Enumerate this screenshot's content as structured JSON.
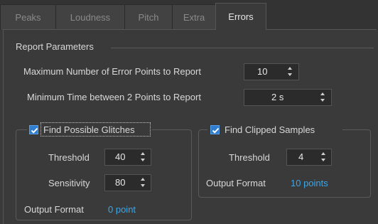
{
  "tabs": [
    {
      "label": "Peaks",
      "active": false
    },
    {
      "label": "Loudness",
      "active": false
    },
    {
      "label": "Pitch",
      "active": false
    },
    {
      "label": "Extra",
      "active": false
    },
    {
      "label": "Errors",
      "active": true
    }
  ],
  "report": {
    "title": "Report Parameters",
    "max_points_label": "Maximum Number of Error Points to Report",
    "max_points_value": "10",
    "min_time_label": "Minimum Time between 2 Points to Report",
    "min_time_value": "2 s"
  },
  "glitches": {
    "title": "Find Possible Glitches",
    "checked": true,
    "threshold_label": "Threshold",
    "threshold_value": "40",
    "sensitivity_label": "Sensitivity",
    "sensitivity_value": "80",
    "output_label": "Output Format",
    "output_value": "0 point"
  },
  "clipped": {
    "title": "Find Clipped Samples",
    "checked": true,
    "threshold_label": "Threshold",
    "threshold_value": "4",
    "output_label": "Output Format",
    "output_value": "10 points"
  },
  "colors": {
    "background": "#3a3a3a",
    "accent_link": "#3ea6e6",
    "checkbox": "#2f7dd1"
  }
}
